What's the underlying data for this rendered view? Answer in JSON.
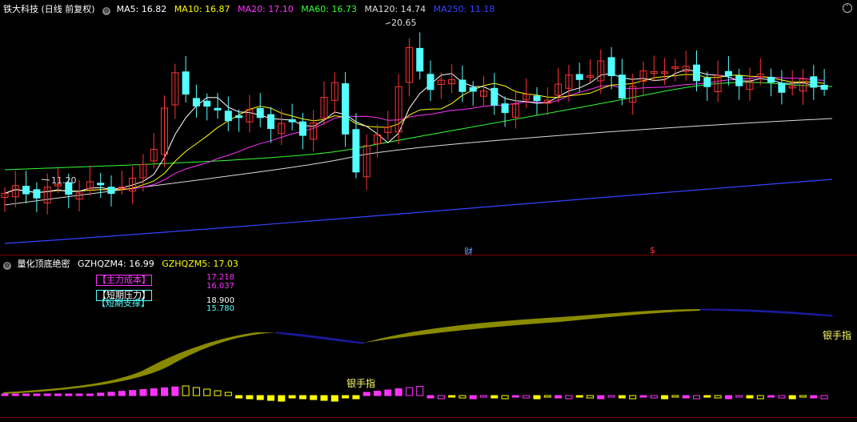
{
  "main_header": {
    "title": "铁大科技 (日线 前复权)",
    "ma": [
      {
        "label": "MA5: 16.82",
        "color": "#ffffff"
      },
      {
        "label": "MA10: 16.87",
        "color": "#ffff00"
      },
      {
        "label": "MA20: 17.10",
        "color": "#ff33ff"
      },
      {
        "label": "MA60: 16.73",
        "color": "#33ff33"
      },
      {
        "label": "MA120: 14.74",
        "color": "#dddddd"
      },
      {
        "label": "MA250: 11.18",
        "color": "#3344ff"
      }
    ]
  },
  "annotations": {
    "high": "20.65",
    "low": "11.20",
    "marker_cai": "财",
    "marker_dollar": "$"
  },
  "sub_header": {
    "title": "量化顶底绝密",
    "v1": "GZHQZM4: 16.99",
    "v2": "GZHQZM5: 17.03"
  },
  "indicator_box": {
    "zhuli": "【主力成本】",
    "duanqi_yali": "【短期压力】",
    "duanqi_zhicheng": "【短期支撑】",
    "val1": "17.218",
    "val2": "16.037",
    "val3": "18.900",
    "val4": "15.780"
  },
  "signals": {
    "right": "银手指",
    "mid": "银手指"
  },
  "colors": {
    "up": "#ff3333",
    "down": "#54ffff",
    "ma5": "#ffffff",
    "ma10": "#ffff00",
    "ma20": "#ff33ff",
    "ma60": "#33ff33",
    "ma120": "#dddddd",
    "ma250": "#3344ff",
    "olive": "#8a8a00",
    "navy": "#1a1a9a"
  }
}
